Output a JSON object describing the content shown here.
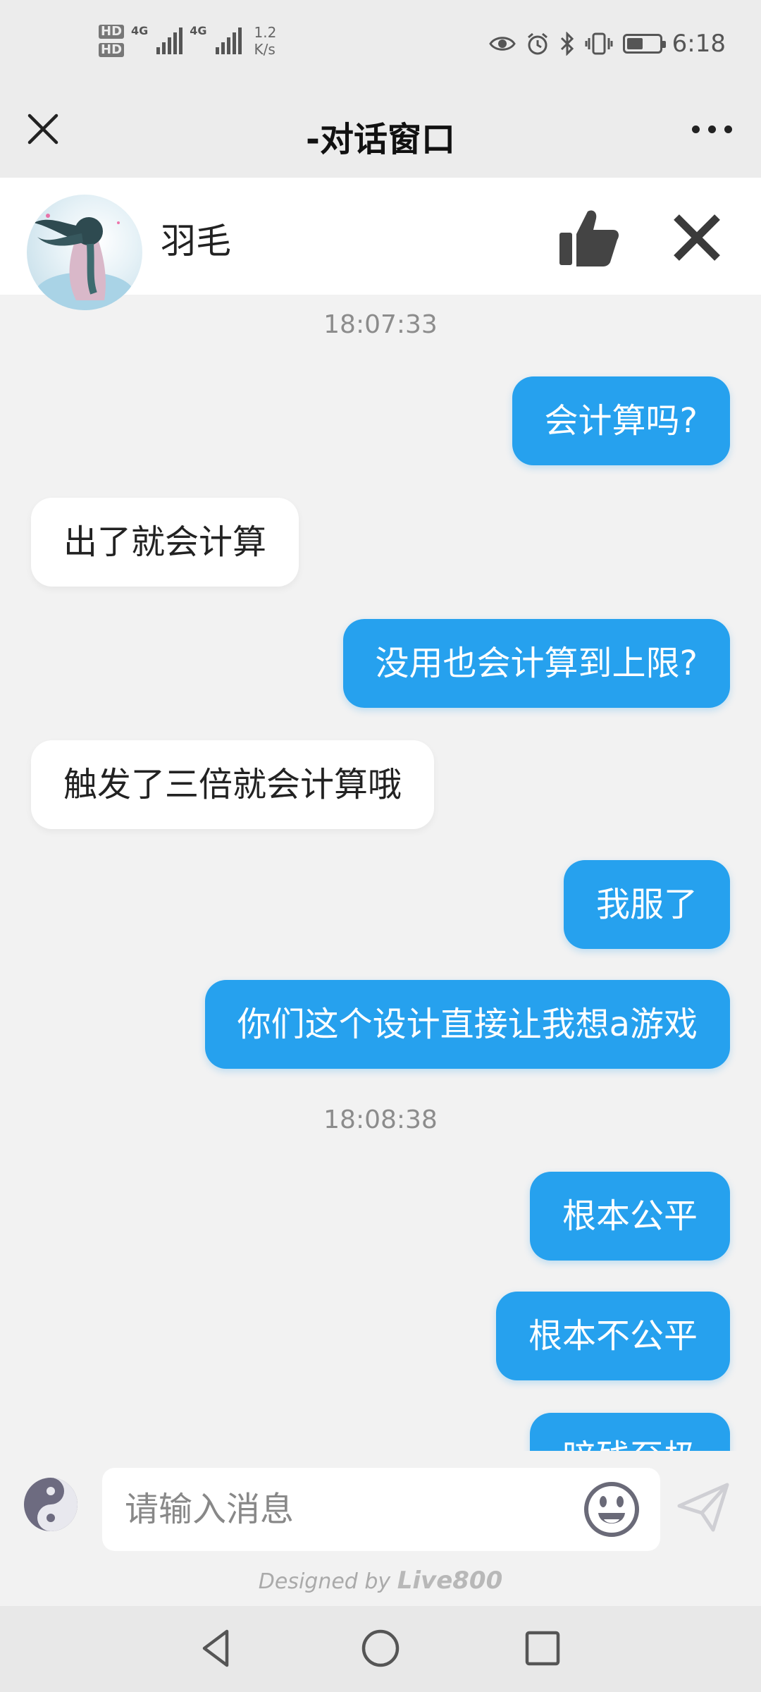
{
  "status_bar": {
    "hd1": "HD",
    "hd2": "HD",
    "net_type_1": "4G",
    "net_type_2": "4G",
    "net_speed_value": "1.2",
    "net_speed_unit": "K/s",
    "time": "6:18",
    "battery_level": 0.45
  },
  "title_bar": {
    "title": "-对话窗口",
    "close_icon": "close-icon",
    "more_icon": "more-icon"
  },
  "agent": {
    "name": "羽毛",
    "like_icon": "thumbs-up-icon",
    "close_icon": "close-icon"
  },
  "chat": {
    "timestamps": [
      "18:07:33",
      "18:08:38"
    ],
    "messages": [
      {
        "dir": "out",
        "text": "会计算吗?"
      },
      {
        "dir": "in",
        "text": "出了就会计算"
      },
      {
        "dir": "out",
        "text": "没用也会计算到上限?"
      },
      {
        "dir": "in",
        "text": "触发了三倍就会计算哦"
      },
      {
        "dir": "out",
        "text": "我服了"
      },
      {
        "dir": "out",
        "text": "你们这个设计直接让我想a游戏"
      },
      {
        "dir": "out",
        "text": "根本公平"
      },
      {
        "dir": "out",
        "text": "根本不公平"
      },
      {
        "dir": "out",
        "text": "暗残至极"
      }
    ]
  },
  "input": {
    "placeholder": "请输入消息",
    "value": "",
    "emoji_icon": "emoji-icon",
    "send_icon": "send-icon",
    "left_icon": "yin-yang-icon"
  },
  "footer": {
    "designed_by": "Designed by",
    "brand": "Live800"
  },
  "nav": {
    "back_icon": "back-triangle-icon",
    "home_icon": "home-circle-icon",
    "recent_icon": "recent-square-icon"
  },
  "colors": {
    "accent": "#26a1ee",
    "background": "#f2f2f2",
    "bar": "#ececec"
  }
}
